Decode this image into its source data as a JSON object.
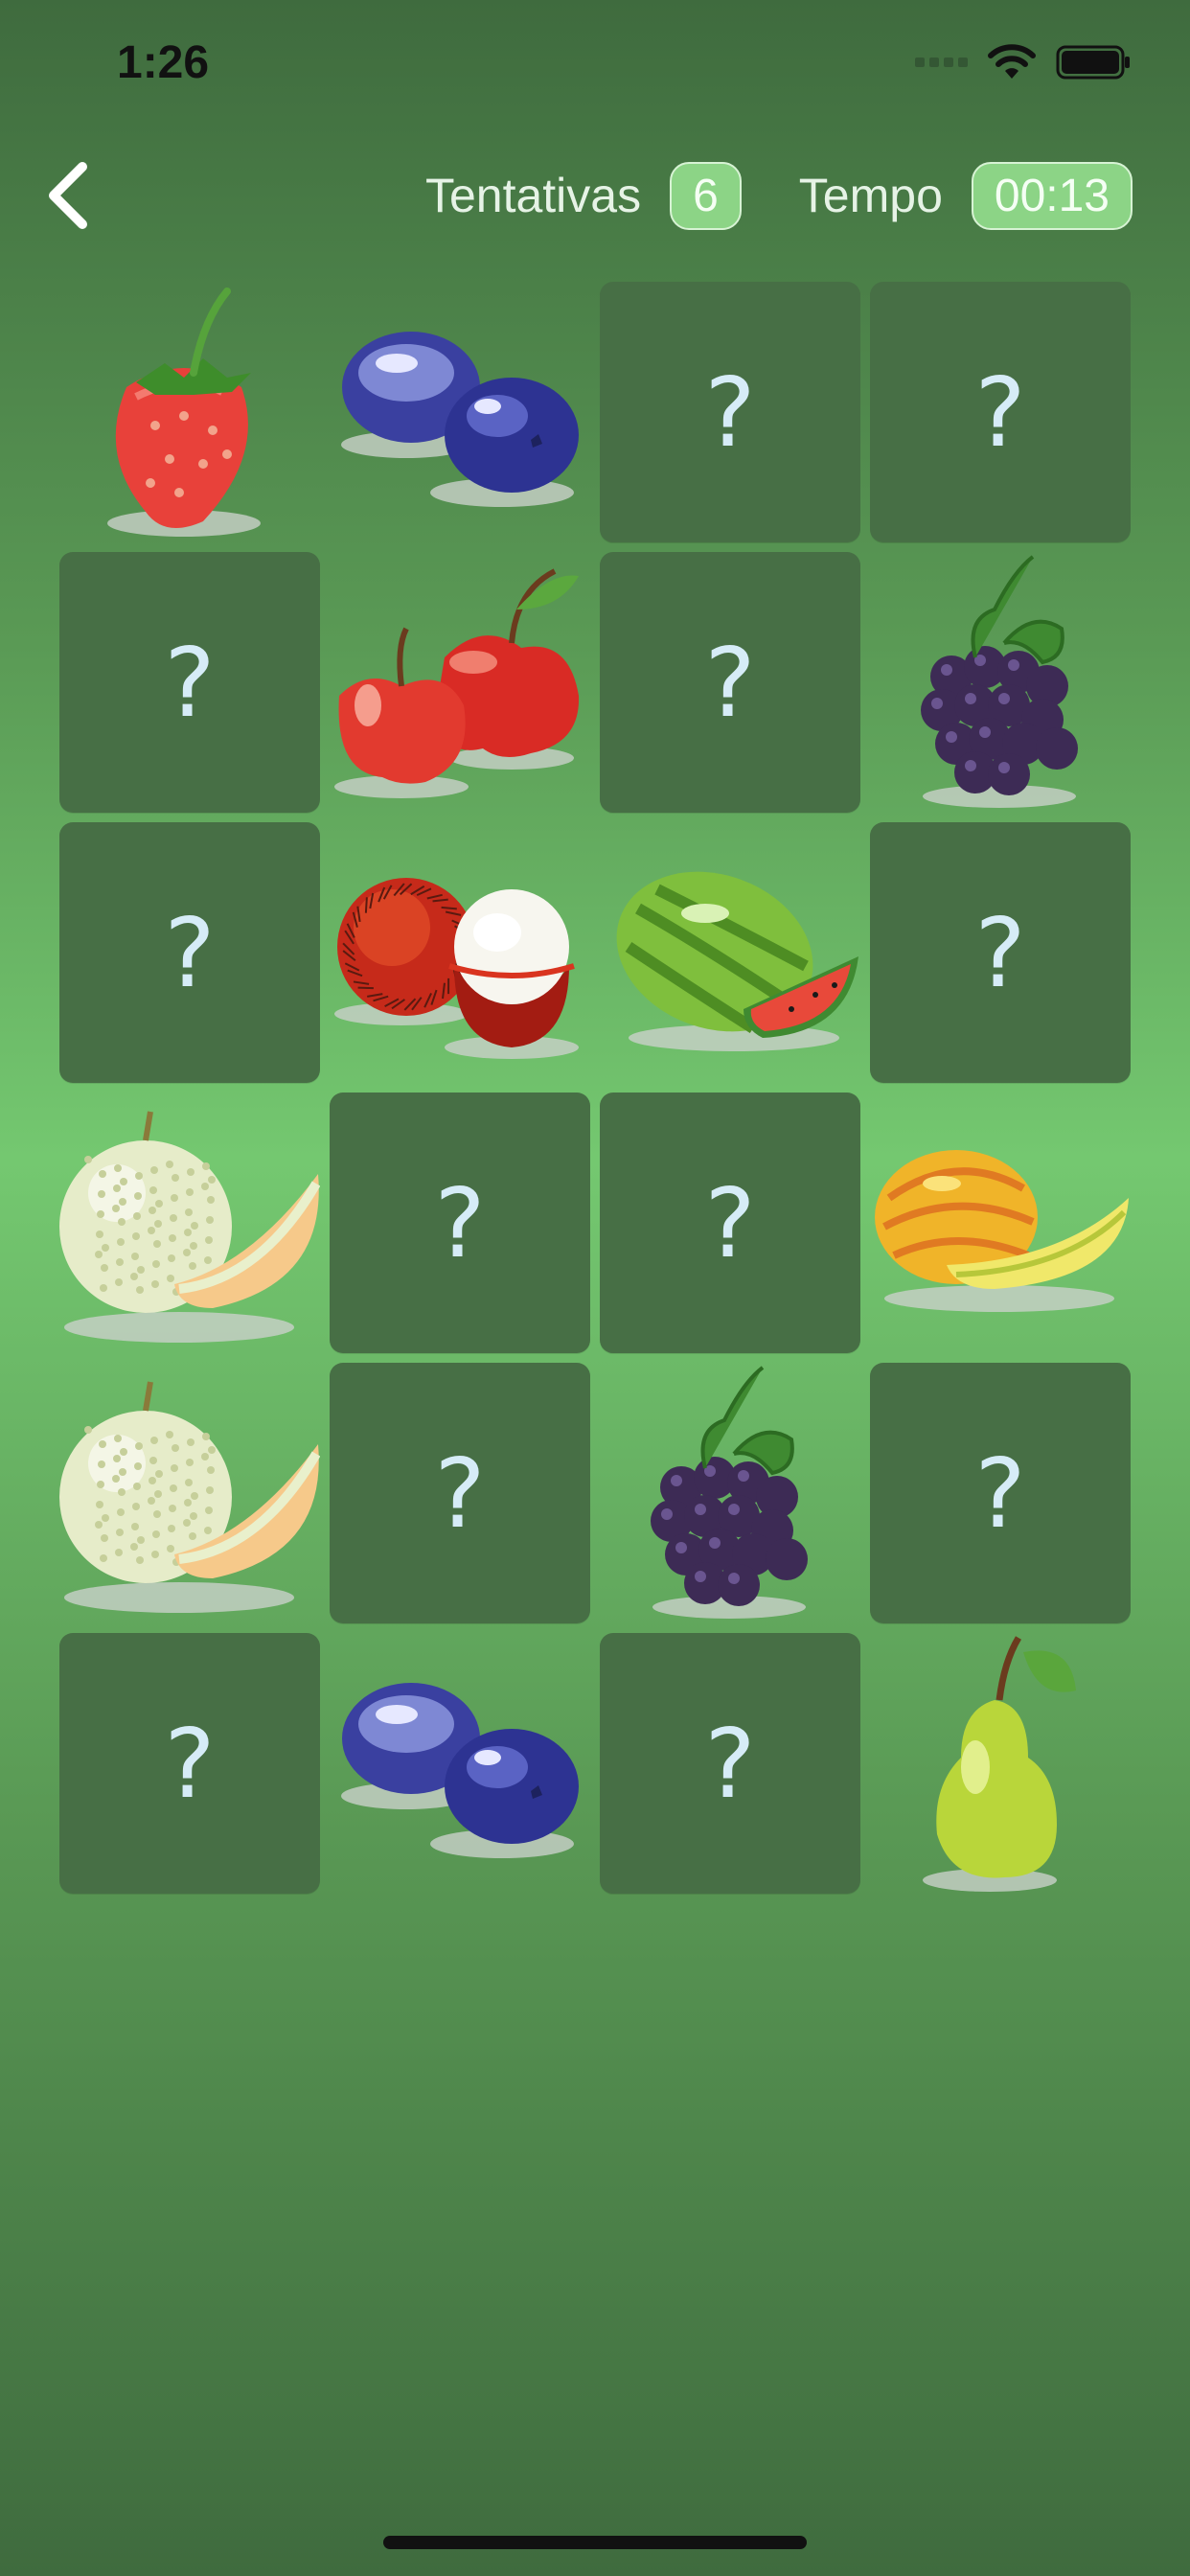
{
  "status_bar": {
    "time": "1:26"
  },
  "header": {
    "attempts_label": "Tentativas",
    "attempts_value": "6",
    "time_label": "Tempo",
    "time_value": "00:13"
  },
  "board": {
    "hidden_symbol": "?",
    "cards": [
      {
        "state": "revealed",
        "fruit": "strawberry"
      },
      {
        "state": "revealed",
        "fruit": "blueberry"
      },
      {
        "state": "hidden"
      },
      {
        "state": "hidden"
      },
      {
        "state": "hidden"
      },
      {
        "state": "revealed",
        "fruit": "apple"
      },
      {
        "state": "hidden"
      },
      {
        "state": "revealed",
        "fruit": "blackberry"
      },
      {
        "state": "hidden"
      },
      {
        "state": "revealed",
        "fruit": "rambutan"
      },
      {
        "state": "revealed",
        "fruit": "watermelon"
      },
      {
        "state": "hidden"
      },
      {
        "state": "revealed",
        "fruit": "cantaloupe"
      },
      {
        "state": "hidden"
      },
      {
        "state": "hidden"
      },
      {
        "state": "revealed",
        "fruit": "yellow-melon"
      },
      {
        "state": "revealed",
        "fruit": "cantaloupe"
      },
      {
        "state": "hidden"
      },
      {
        "state": "revealed",
        "fruit": "blackberry"
      },
      {
        "state": "hidden"
      },
      {
        "state": "hidden"
      },
      {
        "state": "revealed",
        "fruit": "blueberry"
      },
      {
        "state": "hidden"
      },
      {
        "state": "revealed",
        "fruit": "pear"
      }
    ]
  },
  "icons": {
    "back": "chevron-left-icon",
    "wifi": "wifi-icon",
    "battery": "battery-icon",
    "signal": "signal-icon"
  }
}
